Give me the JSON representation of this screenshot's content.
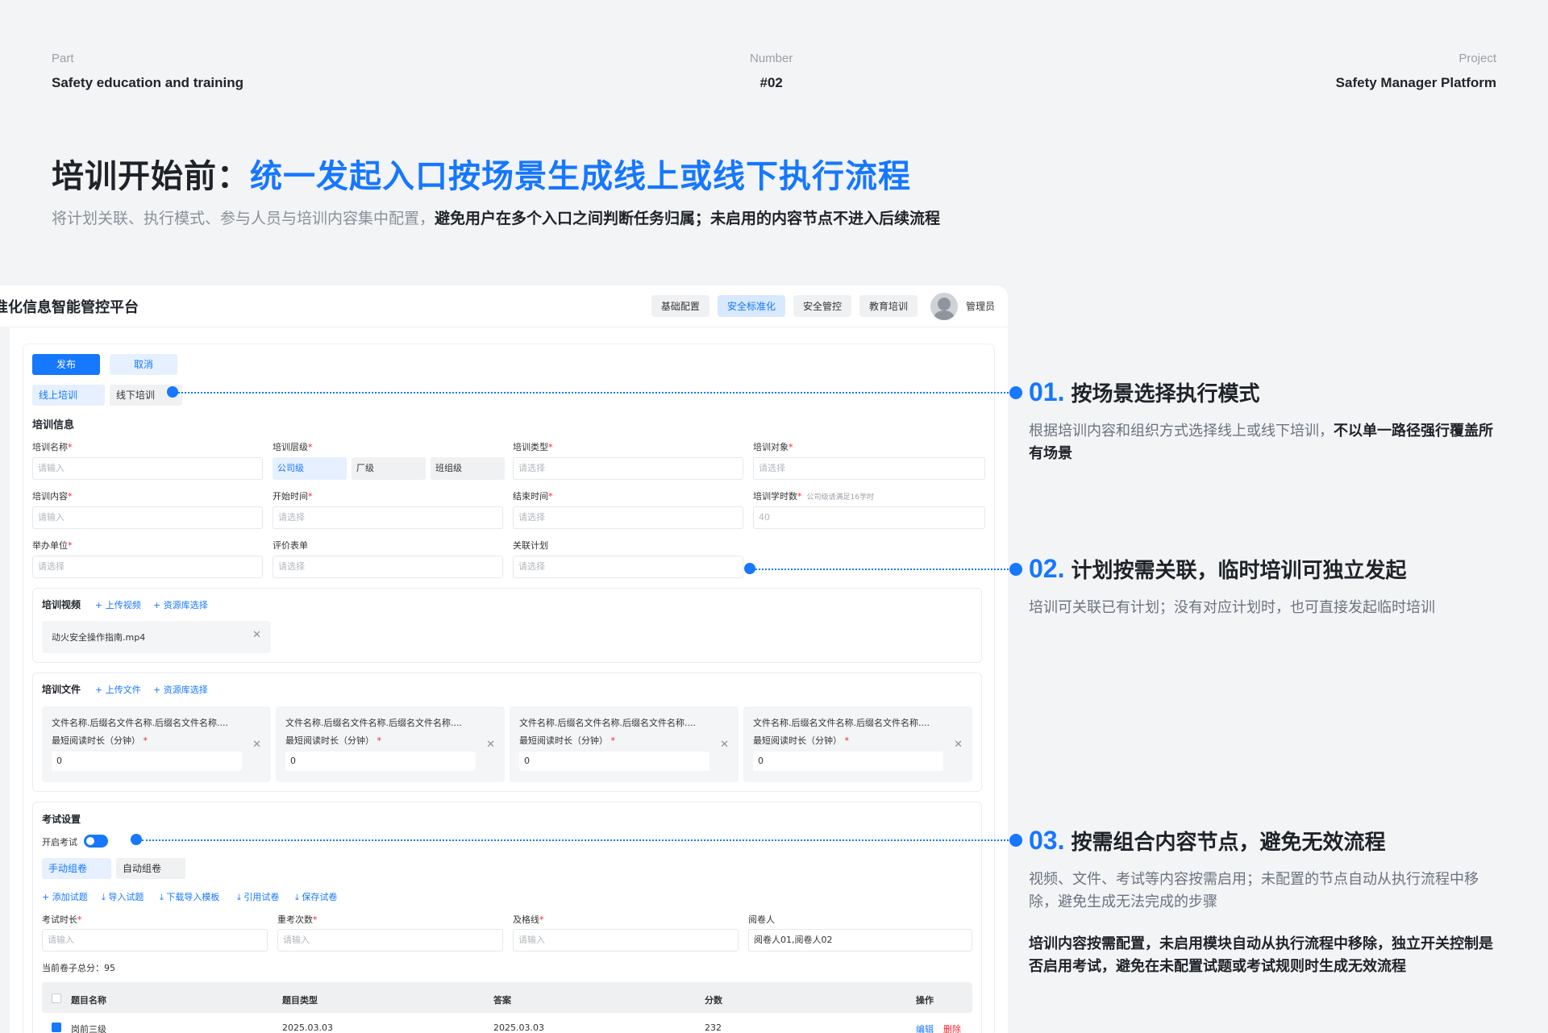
{
  "meta": {
    "part_key": "Part",
    "part_val": "Safety education and training",
    "number_key": "Number",
    "number_val": "#02",
    "project_key": "Project",
    "project_val": "Safety Manager Platform"
  },
  "headline": {
    "prefix": "培训开始前：",
    "highlight": "统一发起入口按场景生成线上或线下执行流程"
  },
  "subline": {
    "normal": "将计划关联、执行模式、参与人员与培训内容集中配置，",
    "bold": "避免用户在多个入口之间判断任务归属；未启用的内容节点不进入后续流程"
  },
  "app": {
    "title": "准化信息智能管控平台",
    "nav": [
      "基础配置",
      "安全标准化",
      "安全管控",
      "教育培训"
    ],
    "user": "管理员",
    "publish": "发布",
    "cancel": "取消",
    "modes": [
      "线上培训",
      "线下培训"
    ],
    "info_title": "培训信息",
    "fields": {
      "name_label": "培训名称",
      "name_ph": "请输入",
      "level_label": "培训层级",
      "levels": [
        "公司级",
        "厂级",
        "班组级"
      ],
      "type_label": "培训类型",
      "type_ph": "请选择",
      "target_label": "培训对象",
      "target_ph": "请选择",
      "content_label": "培训内容",
      "content_ph": "请输入",
      "start_label": "开始时间",
      "start_ph": "请选择",
      "end_label": "结束时间",
      "end_ph": "请选择",
      "hours_label": "培训学时数",
      "hours_hint": "公司级请满足16学时",
      "hours_val": "40",
      "org_label": "举办单位",
      "org_ph": "请选择",
      "eval_label": "评价表单",
      "eval_ph": "请选择",
      "plan_label": "关联计划",
      "plan_ph": "请选择"
    },
    "video": {
      "title": "培训视频",
      "upload": "+ 上传视频",
      "library": "+ 资源库选择",
      "file": "动火安全操作指南.mp4"
    },
    "docs": {
      "title": "培训文件",
      "upload": "+ 上传文件",
      "library": "+ 资源库选择",
      "items": [
        {
          "name": "文件名称.后缀名文件名称.后缀名文件名称....",
          "label": "最短阅读时长（分钟）",
          "value": "0"
        },
        {
          "name": "文件名称.后缀名文件名称.后缀名文件名称....",
          "label": "最短阅读时长（分钟）",
          "value": "0"
        },
        {
          "name": "文件名称.后缀名文件名称.后缀名文件名称....",
          "label": "最短阅读时长（分钟）",
          "value": "0"
        },
        {
          "name": "文件名称.后缀名文件名称.后缀名文件名称....",
          "label": "最短阅读时长（分钟）",
          "value": "0"
        }
      ]
    },
    "exam": {
      "title": "考试设置",
      "enable_label": "开启考试",
      "modes": [
        "手动组卷",
        "自动组卷"
      ],
      "actions": [
        "+ 添加试题",
        "⤓ 导入试题",
        "⤓ 下载导入模板",
        "⤓ 引用试卷",
        "⤓ 保存试卷"
      ],
      "duration_label": "考试时长",
      "duration_ph": "请输入",
      "retake_label": "重考次数",
      "retake_ph": "请输入",
      "pass_label": "及格线",
      "pass_ph": "请输入",
      "grader_label": "阅卷人",
      "grader_val": "阅卷人01,阅卷人02",
      "total_label": "当前卷子总分：95"
    },
    "table": {
      "headers": [
        "题目名称",
        "题目类型",
        "答案",
        "分数",
        "操作"
      ],
      "row": [
        "岗前三级",
        "2025.03.03",
        "2025.03.03",
        "232"
      ],
      "edit": "编辑",
      "delete": "删除"
    }
  },
  "callouts": [
    {
      "num": "01.",
      "title": "按场景选择执行模式",
      "desc": "根据培训内容和组织方式选择线上或线下培训，",
      "desc_bold": "不以单一路径强行覆盖所有场景"
    },
    {
      "num": "02.",
      "title": "计划按需关联，临时培训可独立发起",
      "desc": "培训可关联已有计划；没有对应计划时，也可直接发起临时培训"
    },
    {
      "num": "03.",
      "title": "按需组合内容节点，避免无效流程",
      "desc": "视频、文件、考试等内容按需启用；未配置的节点自动从执行流程中移除，避免生成无法完成的步骤",
      "desc2": "培训内容按需配置，未启用模块自动从执行流程中移除，独立开关控制是否启用考试，避免在未配置试题或考试规则时生成无效流程"
    }
  ],
  "colors": {
    "accent": "#1677ff",
    "bg": "#f3f4f6"
  }
}
